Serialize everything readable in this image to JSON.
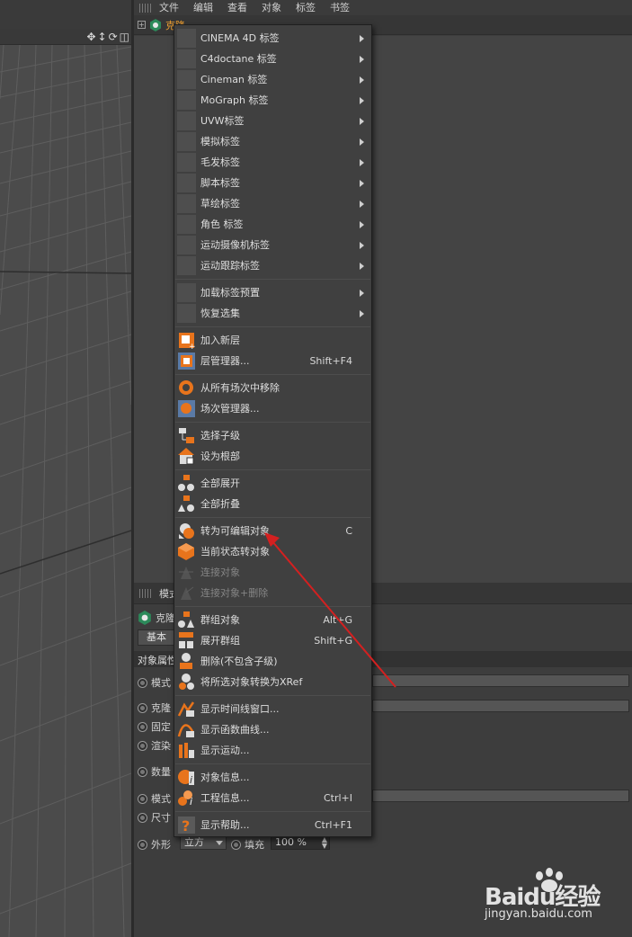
{
  "menubar": {
    "items": [
      "文件",
      "编辑",
      "查看",
      "对象",
      "标签",
      "书签"
    ]
  },
  "object_manager": {
    "selected_object": "克隆"
  },
  "context_menu": {
    "sections": [
      {
        "items": [
          {
            "label": "CINEMA 4D 标签",
            "submenu": true,
            "icon": "blank"
          },
          {
            "label": "C4doctane 标签",
            "submenu": true,
            "icon": "blank"
          },
          {
            "label": "Cineman 标签",
            "submenu": true,
            "icon": "blank"
          },
          {
            "label": "MoGraph 标签",
            "submenu": true,
            "icon": "blank"
          },
          {
            "label": "UVW标签",
            "submenu": true,
            "icon": "blank"
          },
          {
            "label": "模拟标签",
            "submenu": true,
            "icon": "blank"
          },
          {
            "label": "毛发标签",
            "submenu": true,
            "icon": "blank"
          },
          {
            "label": "脚本标签",
            "submenu": true,
            "icon": "blank"
          },
          {
            "label": "草绘标签",
            "submenu": true,
            "icon": "blank"
          },
          {
            "label": "角色 标签",
            "submenu": true,
            "icon": "blank"
          },
          {
            "label": "运动摄像机标签",
            "submenu": true,
            "icon": "blank"
          },
          {
            "label": "运动跟踪标签",
            "submenu": true,
            "icon": "blank"
          }
        ]
      },
      {
        "items": [
          {
            "label": "加载标签预置",
            "submenu": true,
            "icon": "blank"
          },
          {
            "label": "恢复选集",
            "submenu": true,
            "icon": "blank"
          }
        ]
      },
      {
        "items": [
          {
            "label": "加入新层",
            "icon": "layer-add-icon"
          },
          {
            "label": "层管理器...",
            "shortcut": "Shift+F4",
            "icon": "layer-manager-icon"
          }
        ]
      },
      {
        "items": [
          {
            "label": "从所有场次中移除",
            "icon": "take-remove-icon"
          },
          {
            "label": "场次管理器...",
            "icon": "take-manager-icon"
          }
        ]
      },
      {
        "items": [
          {
            "label": "选择子级",
            "icon": "select-children-icon"
          },
          {
            "label": "设为根部",
            "icon": "set-root-icon"
          }
        ]
      },
      {
        "items": [
          {
            "label": "全部展开",
            "icon": "expand-all-icon"
          },
          {
            "label": "全部折叠",
            "icon": "collapse-all-icon"
          }
        ]
      },
      {
        "items": [
          {
            "label": "转为可编辑对象",
            "shortcut": "C",
            "icon": "make-editable-icon"
          },
          {
            "label": "当前状态转对象",
            "icon": "current-state-icon"
          },
          {
            "label": "连接对象",
            "icon": "connect-icon",
            "disabled": true
          },
          {
            "label": "连接对象+删除",
            "icon": "connect-delete-icon",
            "disabled": true
          }
        ]
      },
      {
        "items": [
          {
            "label": "群组对象",
            "shortcut": "Alt+G",
            "icon": "group-icon"
          },
          {
            "label": "展开群组",
            "shortcut": "Shift+G",
            "icon": "ungroup-icon"
          },
          {
            "label": "删除(不包含子级)",
            "icon": "delete-keep-children-icon"
          },
          {
            "label": "将所选对象转换为XRef",
            "icon": "xref-icon"
          }
        ]
      },
      {
        "items": [
          {
            "label": "显示时间线窗口...",
            "icon": "timeline-icon"
          },
          {
            "label": "显示函数曲线...",
            "icon": "fcurve-icon"
          },
          {
            "label": "显示运动...",
            "icon": "motion-icon"
          }
        ]
      },
      {
        "items": [
          {
            "label": "对象信息...",
            "icon": "object-info-icon"
          },
          {
            "label": "工程信息...",
            "shortcut": "Ctrl+I",
            "icon": "project-info-icon"
          }
        ]
      },
      {
        "items": [
          {
            "label": "显示帮助...",
            "shortcut": "Ctrl+F1",
            "icon": "help-icon"
          }
        ]
      }
    ]
  },
  "attributes": {
    "header_label": "模式",
    "object_label": "克隆",
    "tab_basic": "基本",
    "section_title": "对象属性",
    "rows": {
      "mode": "模式",
      "clones": "克隆",
      "fixed": "固定",
      "render": "渲染",
      "count": "数量",
      "mode2": "模式",
      "size": "尺寸",
      "shape": "外形",
      "shape_value": "立方",
      "fill": "填充",
      "fill_value": "100 %"
    }
  },
  "watermark": {
    "brand": "Baidu经验",
    "url": "jingyan.baidu.com"
  },
  "colors": {
    "accent_orange": "#e8741c",
    "annotation_red": "#d42020",
    "selected_object": "#f0a030"
  }
}
